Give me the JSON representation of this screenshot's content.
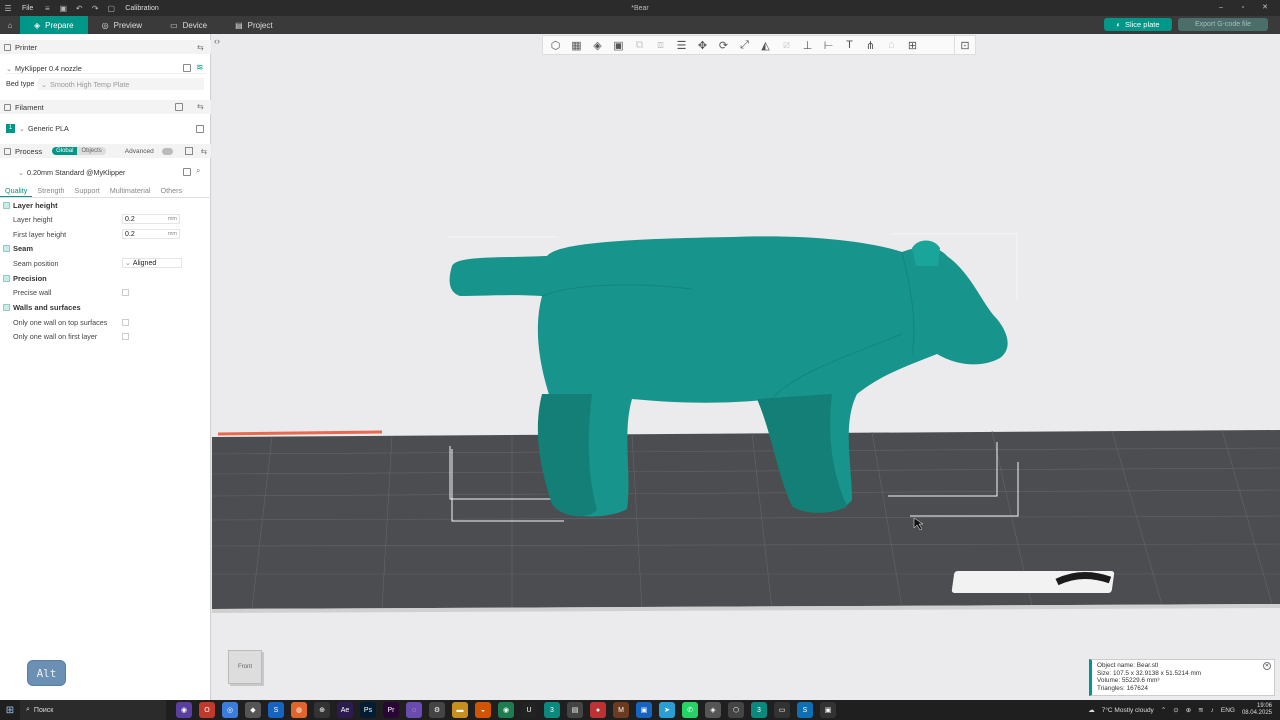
{
  "titlebar": {
    "file_label": "File",
    "calibration_label": "Calibration",
    "document_title": "*Bear"
  },
  "nav": {
    "tabs": [
      "Prepare",
      "Preview",
      "Device",
      "Project"
    ],
    "slice_label": "Slice plate",
    "export_label": "Export G-code file"
  },
  "printer": {
    "section_label": "Printer",
    "name": "MyKlipper 0.4 nozzle",
    "bed_type_label": "Bed type",
    "bed_type_value": "Smooth High Temp Plate"
  },
  "filament": {
    "section_label": "Filament",
    "index": "1",
    "name": "Generic PLA"
  },
  "process": {
    "section_label": "Process",
    "toggle_global": "Global",
    "toggle_objects": "Objects",
    "advanced_label": "Advanced",
    "profile": "0.20mm Standard @MyKlipper",
    "tabs": [
      "Quality",
      "Strength",
      "Support",
      "Multimaterial",
      "Others"
    ]
  },
  "quality": {
    "layer_height_group": "Layer height",
    "layer_height_label": "Layer height",
    "layer_height_value": "0.2",
    "first_layer_height_label": "First layer height",
    "first_layer_height_value": "0.2",
    "unit": "mm",
    "seam_group": "Seam",
    "seam_position_label": "Seam position",
    "seam_position_value": "Aligned",
    "precision_group": "Precision",
    "precise_wall_label": "Precise wall",
    "walls_group": "Walls and surfaces",
    "one_wall_top_label": "Only one wall on top surfaces",
    "one_wall_first_label": "Only one wall on first layer"
  },
  "viewport": {
    "front_label": "Front",
    "alt_label": "Alt",
    "model_color": "#17948b"
  },
  "object_info": {
    "name": "Object name: Bear.stl",
    "size": "Size: 107.5 x 32.9138 x 51.5214 mm",
    "volume": "Volume: 55229.6 mm³",
    "triangles": "Triangles: 167624"
  },
  "taskbar": {
    "search_label": "Поиск",
    "weather": "7°C  Mostly cloudy",
    "lang": "ENG",
    "time": "19:06",
    "date": "08.04.2025"
  }
}
